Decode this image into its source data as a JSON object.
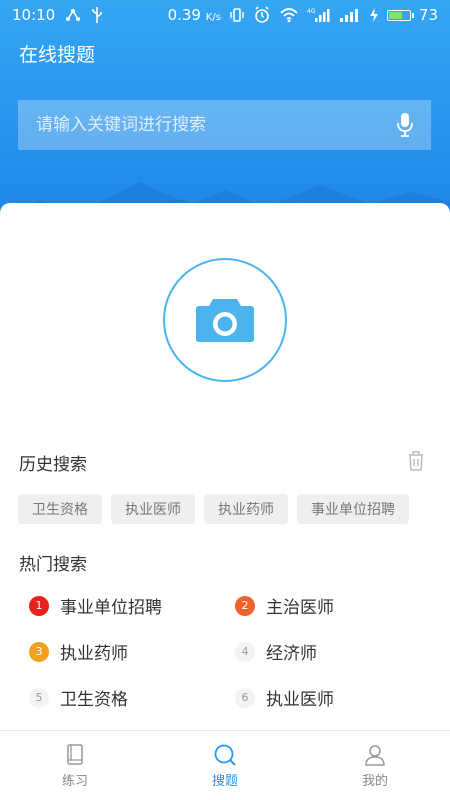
{
  "status_bar": {
    "time": "10:10",
    "speed": "0.39",
    "speed_unit": "K/s",
    "network_type": "4G",
    "battery": "73",
    "battery_level": 0.73
  },
  "header": {
    "title": "在线搜题",
    "search_placeholder": "请输入关键词进行搜索"
  },
  "colors": {
    "brand_blue": "#2a95ee",
    "rank_1": "#e8231c",
    "rank_2": "#f0622b",
    "rank_3": "#f5a01c"
  },
  "history": {
    "title": "历史搜索",
    "tags": [
      "卫生资格",
      "执业医师",
      "执业药师",
      "事业单位招聘"
    ]
  },
  "hot": {
    "title": "热门搜索",
    "items": [
      {
        "rank": "1",
        "label": "事业单位招聘"
      },
      {
        "rank": "2",
        "label": "主治医师"
      },
      {
        "rank": "3",
        "label": "执业药师"
      },
      {
        "rank": "4",
        "label": "经济师"
      },
      {
        "rank": "5",
        "label": "卫生资格"
      },
      {
        "rank": "6",
        "label": "执业医师"
      }
    ]
  },
  "tabbar": {
    "tabs": [
      {
        "label": "练习",
        "icon": "book-icon"
      },
      {
        "label": "搜题",
        "icon": "search-icon",
        "active": true
      },
      {
        "label": "我的",
        "icon": "person-icon"
      }
    ]
  }
}
